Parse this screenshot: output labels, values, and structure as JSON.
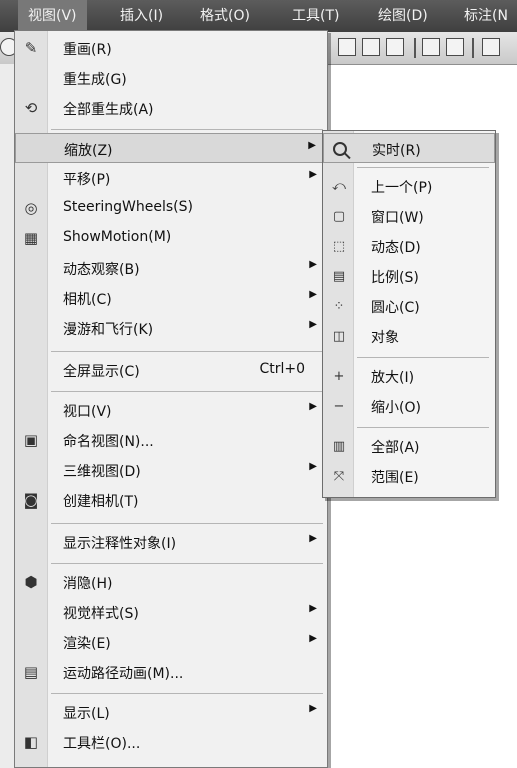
{
  "menubar": {
    "items": [
      "视图(V)",
      "插入(I)",
      "格式(O)",
      "工具(T)",
      "绘图(D)",
      "标注(N"
    ]
  },
  "view_menu": {
    "items": [
      {
        "label": "重画(R)",
        "icon": "pen-icon"
      },
      {
        "label": "重生成(G)"
      },
      {
        "label": "全部重生成(A)",
        "icon": "regen-all-icon"
      },
      {
        "label": "缩放(Z)",
        "submenu": true,
        "highlighted": true
      },
      {
        "label": "平移(P)",
        "submenu": true
      },
      {
        "label": "SteeringWheels(S)",
        "icon": "steeringwheel-icon"
      },
      {
        "label": "ShowMotion(M)",
        "icon": "showmotion-icon"
      },
      {
        "label": "动态观察(B)",
        "submenu": true
      },
      {
        "label": "相机(C)",
        "submenu": true
      },
      {
        "label": "漫游和飞行(K)",
        "submenu": true
      },
      {
        "label": "全屏显示(C)",
        "shortcut": "Ctrl+0"
      },
      {
        "label": "视口(V)",
        "submenu": true
      },
      {
        "label": "命名视图(N)...",
        "icon": "named-view-icon"
      },
      {
        "label": "三维视图(D)",
        "submenu": true
      },
      {
        "label": "创建相机(T)",
        "icon": "camera-icon"
      },
      {
        "label": "显示注释性对象(I)",
        "submenu": true
      },
      {
        "label": "消隐(H)",
        "icon": "hide-icon"
      },
      {
        "label": "视觉样式(S)",
        "submenu": true
      },
      {
        "label": "渲染(E)",
        "submenu": true
      },
      {
        "label": "运动路径动画(M)...",
        "icon": "film-icon"
      },
      {
        "label": "显示(L)",
        "submenu": true
      },
      {
        "label": "工具栏(O)...",
        "icon": "toolbar-icon"
      }
    ]
  },
  "zoom_submenu": {
    "items": [
      {
        "label": "实时(R)",
        "icon": "zoom-realtime-icon",
        "highlighted": true
      },
      {
        "label": "上一个(P)",
        "icon": "zoom-previous-icon"
      },
      {
        "label": "窗口(W)",
        "icon": "zoom-window-icon"
      },
      {
        "label": "动态(D)",
        "icon": "zoom-dynamic-icon"
      },
      {
        "label": "比例(S)",
        "icon": "zoom-scale-icon"
      },
      {
        "label": "圆心(C)",
        "icon": "zoom-center-icon"
      },
      {
        "label": "对象",
        "icon": "zoom-object-icon"
      },
      {
        "label": "放大(I)",
        "icon": "zoom-in-icon"
      },
      {
        "label": "缩小(O)",
        "icon": "zoom-out-icon"
      },
      {
        "label": "全部(A)",
        "icon": "zoom-all-icon"
      },
      {
        "label": "范围(E)",
        "icon": "zoom-extents-icon"
      }
    ]
  },
  "colors": {
    "menubar_bg": "#4a4a4a",
    "menu_bg": "#f1f1f1",
    "highlight": "#d9d9d9"
  }
}
